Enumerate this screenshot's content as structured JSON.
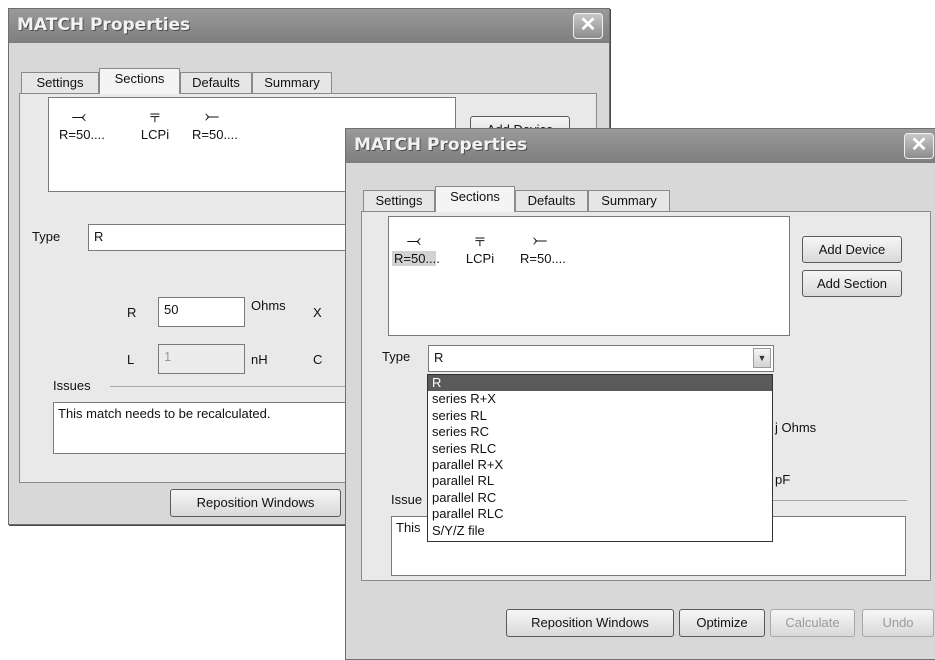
{
  "back_dialog": {
    "title": "MATCH Properties",
    "close_glyph": "✕",
    "tabs": [
      "Settings",
      "Sections",
      "Defaults",
      "Summary"
    ],
    "devices": [
      {
        "icon": "⤙",
        "label": "R=50...."
      },
      {
        "icon": "⫧",
        "label": "LCPi"
      },
      {
        "icon": "⤚",
        "label": "R=50...."
      }
    ],
    "add_device_label": "Add Device",
    "type_label": "Type",
    "type_value": "R",
    "r_label": "R",
    "r_value": "50",
    "ohms_label": "Ohms",
    "x_label": "X",
    "l_label": "L",
    "l_value": "1",
    "nh_label": "nH",
    "c_label": "C",
    "issues_label": "Issues",
    "issues_text": "This match needs to be recalculated.",
    "reposition_label": "Reposition Windows"
  },
  "front_dialog": {
    "title": "MATCH Properties",
    "close_glyph": "✕",
    "tabs": [
      "Settings",
      "Sections",
      "Defaults",
      "Summary"
    ],
    "devices": [
      {
        "icon": "⤙",
        "label": "R=50...."
      },
      {
        "icon": "⫧",
        "label": "LCPi"
      },
      {
        "icon": "⤚",
        "label": "R=50...."
      }
    ],
    "add_device_label": "Add Device",
    "add_section_label": "Add Section",
    "type_label": "Type",
    "type_value": "R",
    "dropdown_arrow": "▼",
    "type_options": [
      "R",
      "series R+X",
      "series RL",
      "series RC",
      "series RLC",
      "parallel R+X",
      "parallel RL",
      "parallel RC",
      "parallel RLC",
      "S/Y/Z file"
    ],
    "j_ohms_label": "j Ohms",
    "pf_label": "pF",
    "issues_label": "Issue",
    "issues_text": "This",
    "buttons": {
      "reposition": "Reposition Windows",
      "optimize": "Optimize",
      "calculate": "Calculate",
      "undo": "Undo"
    }
  }
}
